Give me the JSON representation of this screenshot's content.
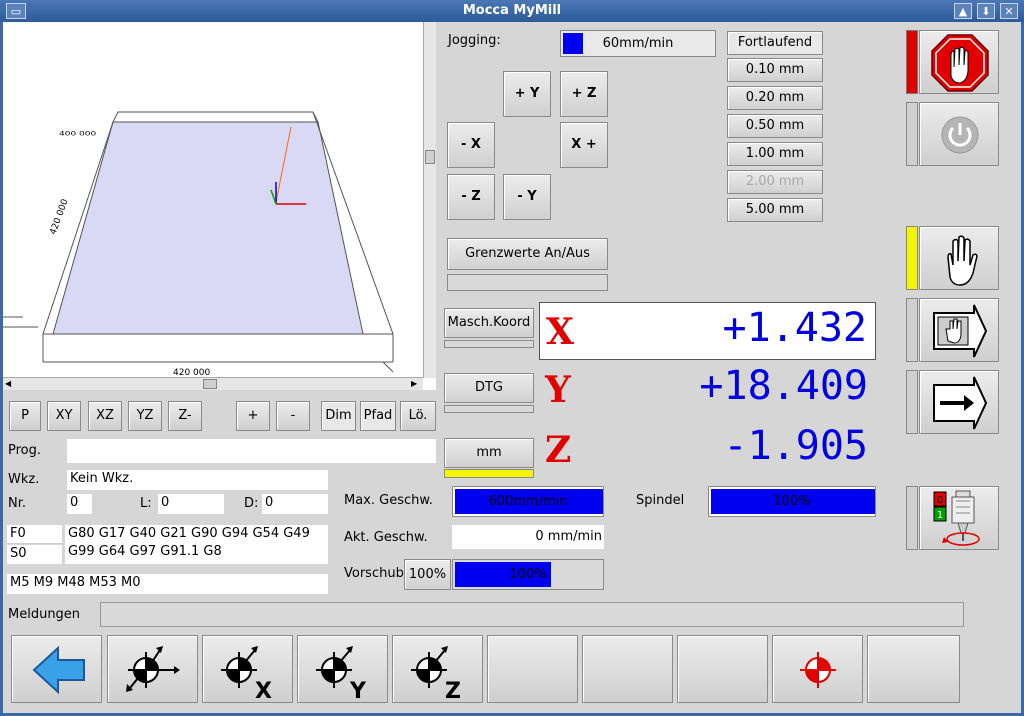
{
  "window": {
    "title": "Mocca MyMill"
  },
  "view": {
    "label_top": "400 000",
    "label_left": "420 000",
    "label_bottom": "420 000"
  },
  "view_buttons": [
    "P",
    "XY",
    "XZ",
    "YZ",
    "Z-",
    "+",
    "-",
    "Dim",
    "Pfad",
    "Lö."
  ],
  "info": {
    "prog_label": "Prog.",
    "prog_value": "",
    "wkz_label": "Wkz.",
    "wkz_value": "Kein Wkz.",
    "nr_label": "Nr.",
    "nr_value": "0",
    "l_label": "L:",
    "l_value": "0",
    "d_label": "D:",
    "d_value": "0",
    "f_value": "F0",
    "s_value": "S0",
    "gcodes_line1": "G80 G17 G40 G21 G90 G94 G54 G49",
    "gcodes_line2": "G99 G64 G97 G91.1 G8",
    "mcodes": "M5 M9 M48 M53 M0",
    "meldungen_label": "Meldungen",
    "meldungen_value": ""
  },
  "jog": {
    "label": "Jogging:",
    "speed": "60mm/min",
    "speed_fraction": 0.06,
    "plus_y": "+ Y",
    "plus_z": "+ Z",
    "minus_x": "- X",
    "x_plus": "X +",
    "minus_z": "- Z",
    "minus_y": "- Y",
    "limits_button": "Grenzwerte An/Aus",
    "steps": [
      "Fortlaufend",
      "0.10 mm",
      "0.20 mm",
      "0.50 mm",
      "1.00 mm",
      "2.00 mm",
      "5.00 mm"
    ],
    "disabled_step": "2.00 mm"
  },
  "coords": {
    "mode_button": "Masch.Koord",
    "dtg_button": "DTG",
    "unit_button": "mm",
    "x_letter": "X",
    "x_value": "+1.432",
    "y_letter": "Y",
    "y_value": "+18.409",
    "z_letter": "Z",
    "z_value": "-1.905"
  },
  "speeds": {
    "max_label": "Max. Geschw.",
    "max_value": "600mm/min",
    "max_fraction": 1.0,
    "akt_label": "Akt. Geschw.",
    "akt_value": "0 mm/min",
    "vorschub_label": "Vorschub",
    "vorschub_button": "100%",
    "vorschub_value": "100%",
    "vorschub_fraction": 1.0,
    "spindel_label": "Spindel",
    "spindel_value": "100%",
    "spindel_fraction": 1.0
  },
  "colors": {
    "accent": "#0000e0",
    "stop_red": "#e00000",
    "warn_yellow": "#f5f500",
    "bar_blue": "#0000f0"
  },
  "toolbar_icons": [
    "back-arrow-icon",
    "zero-all-axes-icon",
    "zero-x-icon",
    "zero-y-icon",
    "zero-z-icon",
    "",
    "",
    "",
    "goto-zero-icon",
    ""
  ],
  "toolbar_texts": {
    "x": "X",
    "y": "Y",
    "z": "Z"
  },
  "spindle_icon_labels": {
    "top": "0",
    "bottom": "1"
  }
}
